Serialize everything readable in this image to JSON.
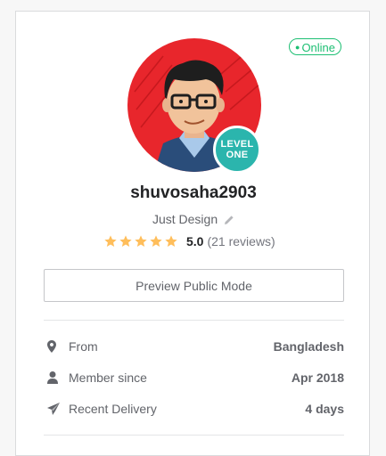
{
  "status": {
    "online_label": "Online",
    "online_color": "#1dbf73"
  },
  "profile": {
    "username": "shuvosaha2903",
    "tagline": "Just Design",
    "level_line1": "LEVEL",
    "level_line2": "ONE",
    "avatar_bg": "#e8262c",
    "level_color": "#2bb5ad"
  },
  "rating": {
    "stars": 5,
    "score": "5.0",
    "reviews": "(21 reviews)",
    "star_color": "#ffbe5b"
  },
  "actions": {
    "preview_label": "Preview Public Mode"
  },
  "details": [
    {
      "icon": "map-marker-icon",
      "label": "From",
      "value": "Bangladesh"
    },
    {
      "icon": "user-icon",
      "label": "Member since",
      "value": "Apr 2018"
    },
    {
      "icon": "paper-plane-icon",
      "label": "Recent Delivery",
      "value": "4 days"
    }
  ]
}
